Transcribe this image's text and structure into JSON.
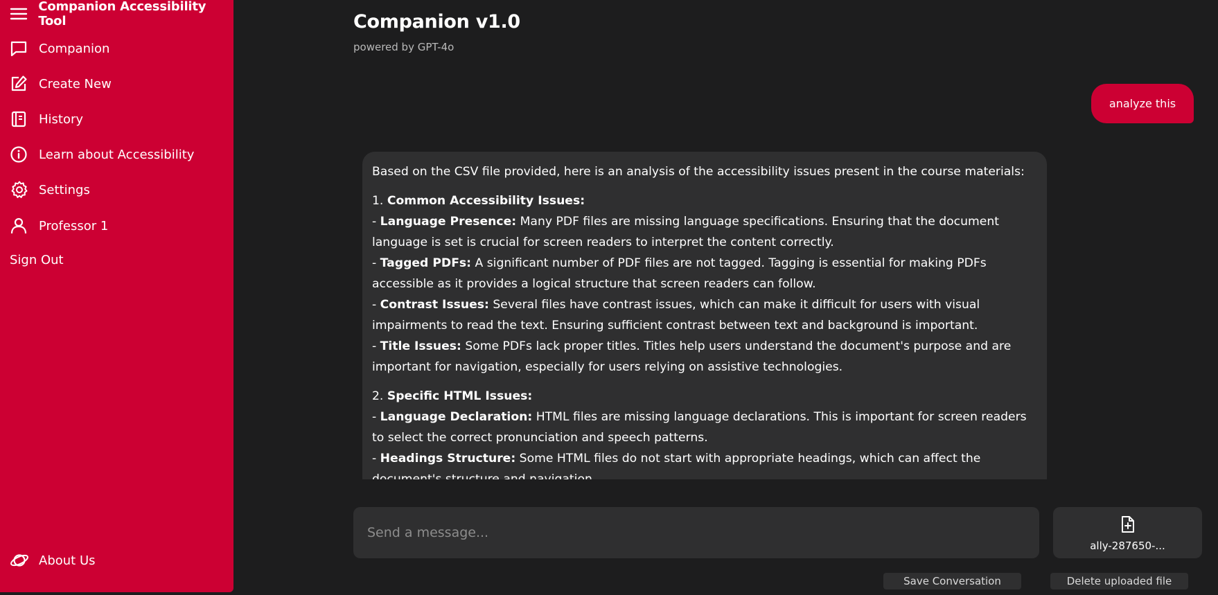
{
  "colors": {
    "accent": "#cc0033",
    "background": "#1d1d1e",
    "panel": "#2f2f30"
  },
  "sidebar": {
    "app_title": "Companion Accessibility Tool",
    "items": [
      {
        "label": "Companion",
        "icon": "chat-bubble-icon"
      },
      {
        "label": "Create New",
        "icon": "edit-icon"
      },
      {
        "label": "History",
        "icon": "notebook-icon"
      },
      {
        "label": "Learn about Accessibility",
        "icon": "info-icon"
      },
      {
        "label": "Settings",
        "icon": "gear-icon"
      },
      {
        "label": "Professor 1",
        "icon": "user-icon"
      }
    ],
    "sign_out": "Sign Out",
    "about": {
      "label": "About Us",
      "icon": "planet-icon"
    }
  },
  "header": {
    "title": "Companion v1.0",
    "subtitle": "powered by GPT-4o"
  },
  "conversation": {
    "user_message": "analyze this",
    "assistant": {
      "intro": "Based on the CSV file provided, here is an analysis of the accessibility issues present in the course materials:",
      "section1": {
        "num": "1. ",
        "title": "Common Accessibility Issues:",
        "items": [
          {
            "term": "Language Presence:",
            "text": " Many PDF files are missing language specifications. Ensuring that the document language is set is crucial for screen readers to interpret the content correctly."
          },
          {
            "term": "Tagged PDFs:",
            "text": " A significant number of PDF files are not tagged. Tagging is essential for making PDFs accessible as it provides a logical structure that screen readers can follow."
          },
          {
            "term": "Contrast Issues:",
            "text": " Several files have contrast issues, which can make it difficult for users with visual impairments to read the text. Ensuring sufficient contrast between text and background is important."
          },
          {
            "term": "Title Issues:",
            "text": " Some PDFs lack proper titles. Titles help users understand the document's purpose and are important for navigation, especially for users relying on assistive technologies."
          }
        ]
      },
      "section2": {
        "num": "2. ",
        "title": "Specific HTML Issues:",
        "items": [
          {
            "term": "Language Declaration:",
            "text": " HTML files are missing language declarations. This is important for screen readers to select the correct pronunciation and speech patterns."
          },
          {
            "term": "Headings Structure:",
            "text": " Some HTML files do not start with appropriate headings, which can affect the document's structure and navigation."
          }
        ]
      }
    }
  },
  "composer": {
    "placeholder": "Send a message...",
    "file_name": "ally-287650-..."
  },
  "actions": {
    "save": "Save Conversation",
    "delete": "Delete uploaded file"
  }
}
